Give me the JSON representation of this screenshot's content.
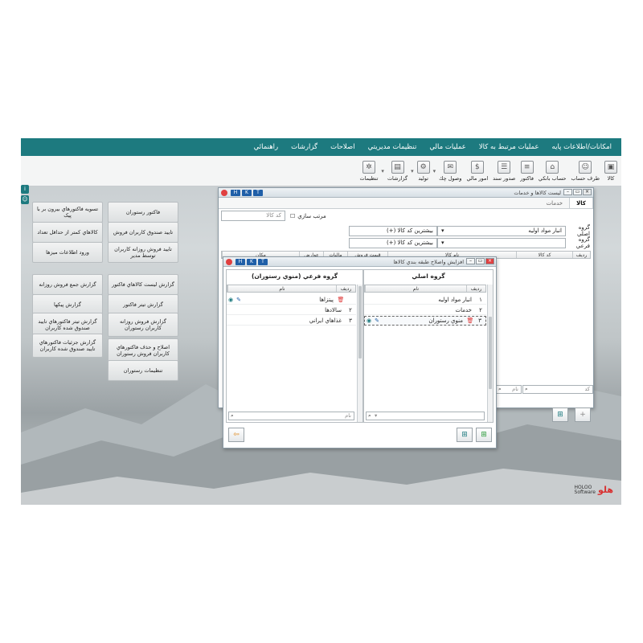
{
  "menu": [
    "امکانات/اطلاعات پایه",
    "عملیات مرتبط به کالا",
    "عملیات مالي",
    "تنظیمات مدیریتي",
    "اصلاحات",
    "گزارشات",
    "راهنمائي"
  ],
  "toolbar": [
    {
      "label": "کالا",
      "icon": "box-icon"
    },
    {
      "label": "طرف حساب",
      "icon": "person-icon"
    },
    {
      "label": "حساب بانکي",
      "icon": "bank-icon"
    },
    {
      "label": "فاکتور",
      "icon": "invoice-icon"
    },
    {
      "label": "صدور سند",
      "icon": "document-icon"
    },
    {
      "label": "امور مالي",
      "icon": "finance-icon"
    },
    {
      "label": "وصول چك",
      "icon": "cheque-icon"
    },
    {
      "label": "تولید",
      "icon": "production-icon"
    },
    {
      "label": "گزارشات",
      "icon": "report-icon"
    },
    {
      "label": "تنظیمات",
      "icon": "gear-icon"
    }
  ],
  "buttons_col1": [
    "فاکتور رستوران",
    "تایید صندوق کاربران فروش",
    "تایید فروش روزانه کاربران توسط مدیر"
  ],
  "buttons_col2": [
    "تسویه فاکتورهاي بیرون بر با پیک",
    "کالاهاي کمتر از حداقل تعداد",
    "ورود اطلاعات میزها"
  ],
  "buttons_col3": [
    "گزارش لیست کالاهاي فاکتور",
    "گزارش تیتر فاکتور",
    "گزارش فروش روزانه کاربران رستوران",
    "اصلاح و حذف فاکتورهاي کاربران فروش رستوران",
    "تنظیمات رستوران"
  ],
  "buttons_col4": [
    "گزارش جمع فروش روزانه",
    "گزارش پیکها",
    "گزارش تیتر فاکتورهاي تایید صندوق شده کاربران",
    "گزارش جزئیات فاکتورهاي تایید صندوق شده کاربران"
  ],
  "goods_window": {
    "title": "لیست کالاها و خدمات",
    "hkt": [
      "H",
      "K",
      "T"
    ],
    "tabs": [
      "کالا",
      "خدمات"
    ],
    "sort_label": "مرتب سازي",
    "code_placeholder": "کد کالا",
    "main_group_label": "گروه اصلي",
    "main_group_value": "انبار مواد اولیه",
    "sub_group_label": "گروه فرعي",
    "max_code_1": "بیشترین کد کالا (+)",
    "max_code_2": "بیشترین کد کالا (+)",
    "columns": [
      "ردیف",
      "کد کالا",
      "نام کالا",
      "قیمت فروش",
      "مالیات",
      "عوارض",
      "مکان"
    ],
    "search_code": "کد",
    "search_name": "نام"
  },
  "category_window": {
    "title": "افزایش واصلاح طبقه بندي کالاها",
    "hkt": [
      "H",
      "K",
      "T"
    ],
    "main_panel_title": "گروه اصلي",
    "sub_panel_title": "گروه فرعي (منوي رستوران)",
    "col_row": "ردیف",
    "col_name": "نام",
    "main_rows": [
      {
        "num": "۱",
        "name": "انبار مواد اولیه"
      },
      {
        "num": "۲",
        "name": "خدمات"
      },
      {
        "num": "۳",
        "name": "منوي رستوران"
      }
    ],
    "sub_rows": [
      {
        "num": "۱",
        "name": "پیتزاها"
      },
      {
        "num": "۲",
        "name": "سالادها"
      },
      {
        "num": "۳",
        "name": "غذاهاي ایراني"
      }
    ],
    "search_placeholder": "نام"
  },
  "logo": {
    "fa": "هلو",
    "en_top": "HOLOO",
    "en_bottom": "Software"
  },
  "colors": {
    "menubar": "#1d7a7f",
    "hkt": "#1f5fa8",
    "close": "#e04040"
  }
}
